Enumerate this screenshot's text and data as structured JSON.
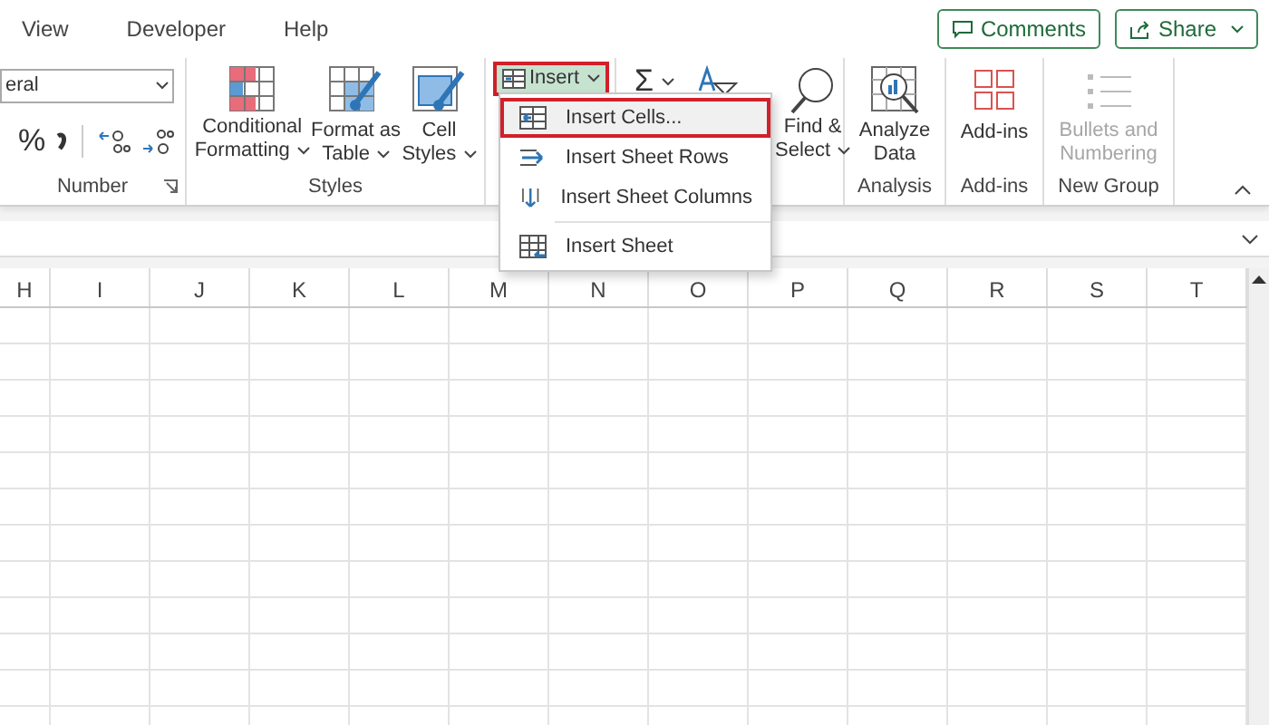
{
  "tabs": [
    {
      "label": "View"
    },
    {
      "label": "Developer"
    },
    {
      "label": "Help"
    }
  ],
  "comments_button": "Comments",
  "share_button": "Share",
  "number_group": {
    "format_value": "eral",
    "percent": "%",
    "label": "Number"
  },
  "styles_group": {
    "label": "Styles",
    "buttons": [
      {
        "kind": "conditional",
        "lines": [
          "Conditional",
          "Formatting"
        ]
      },
      {
        "kind": "table",
        "lines": [
          "Format as",
          "Table"
        ]
      },
      {
        "kind": "cellstyles",
        "lines": [
          "Cell",
          "Styles"
        ]
      }
    ]
  },
  "insert_button": {
    "label": "Insert",
    "selected": true,
    "outlined": true
  },
  "insert_menu": [
    {
      "kind": "cells",
      "label": "Insert Cells...",
      "selected": true,
      "outlined": true
    },
    {
      "kind": "rows",
      "label": "Insert Sheet Rows",
      "selected": false,
      "outlined": false
    },
    {
      "kind": "columns",
      "label": "Insert Sheet Columns",
      "selected": false,
      "outlined": false
    },
    {
      "kind": "sheet",
      "label": "Insert Sheet",
      "selected": false,
      "outlined": false
    }
  ],
  "editing_group": {
    "sum": "Σ",
    "find_lines": [
      "Find &",
      "Select"
    ]
  },
  "analysis_group": {
    "lines": [
      "Analyze",
      "Data"
    ],
    "label": "Analysis"
  },
  "addins_group": {
    "button": "Add-ins",
    "label": "Add-ins"
  },
  "new_group": {
    "lines": [
      "Bullets and",
      "Numbering"
    ],
    "disabled": true,
    "label": "New Group"
  },
  "columns": [
    "H",
    "I",
    "J",
    "K",
    "L",
    "M",
    "N",
    "O",
    "P",
    "Q",
    "R",
    "S",
    "T"
  ]
}
